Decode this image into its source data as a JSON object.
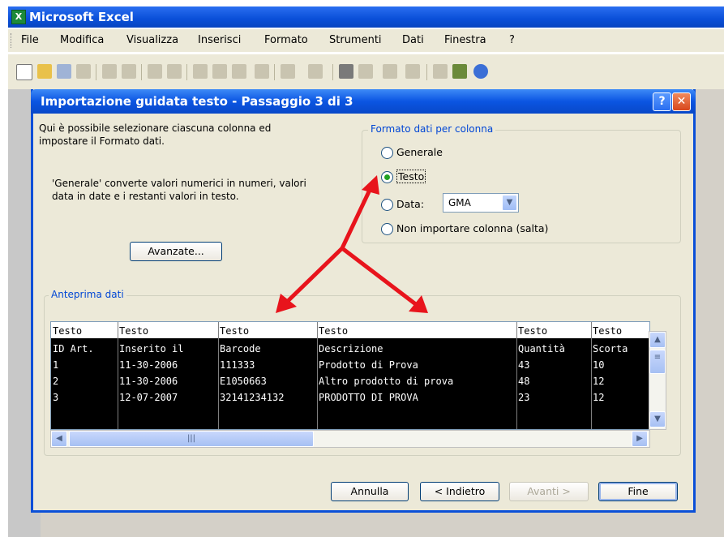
{
  "excel": {
    "app_title": "Microsoft Excel",
    "menu": [
      "File",
      "Modifica",
      "Visualizza",
      "Inserisci",
      "Formato",
      "Strumenti",
      "Dati",
      "Finestra",
      "?"
    ]
  },
  "dialog": {
    "title": "Importazione guidata testo - Passaggio 3 di 3",
    "help_label": "?",
    "close_label": "✕",
    "intro_line1": "Qui è possibile selezionare ciascuna colonna ed",
    "intro_line2": "impostare il Formato dati.",
    "general_line1": "'Generale' converte valori numerici in numeri, valori",
    "general_line2": "data in date e i restanti valori in testo.",
    "advanced_button": "Avanzate...",
    "format_group": {
      "legend": "Formato dati per colonna",
      "options": [
        "Generale",
        "Testo",
        "Data:",
        "Non importare colonna (salta)"
      ],
      "selected": "Testo",
      "date_value": "GMA"
    },
    "preview": {
      "legend": "Anteprima dati",
      "headers": [
        "Testo",
        "Testo",
        "Testo",
        "Testo",
        "Testo",
        "Testo"
      ],
      "rows": [
        [
          "ID Art.",
          "Inserito il",
          "Barcode",
          "Descrizione",
          "Quantità",
          "Scorta"
        ],
        [
          "1",
          "11-30-2006",
          "111333",
          "Prodotto di Prova",
          "43",
          "10"
        ],
        [
          "2",
          "11-30-2006",
          "E1050663",
          "Altro prodotto di prova",
          "48",
          "12"
        ],
        [
          "3",
          "12-07-2007",
          "32141234132",
          "PRODOTTO DI PROVA",
          "23",
          "12"
        ]
      ]
    },
    "buttons": {
      "cancel": "Annulla",
      "back": "< Indietro",
      "next": "Avanti >",
      "finish": "Fine"
    }
  },
  "colors": {
    "titlebar": "#0a4fd8",
    "dialog_bg": "#ece9d8",
    "legend_text": "#0046d5",
    "arrow": "#e8141c",
    "radio_check": "#21a121"
  }
}
